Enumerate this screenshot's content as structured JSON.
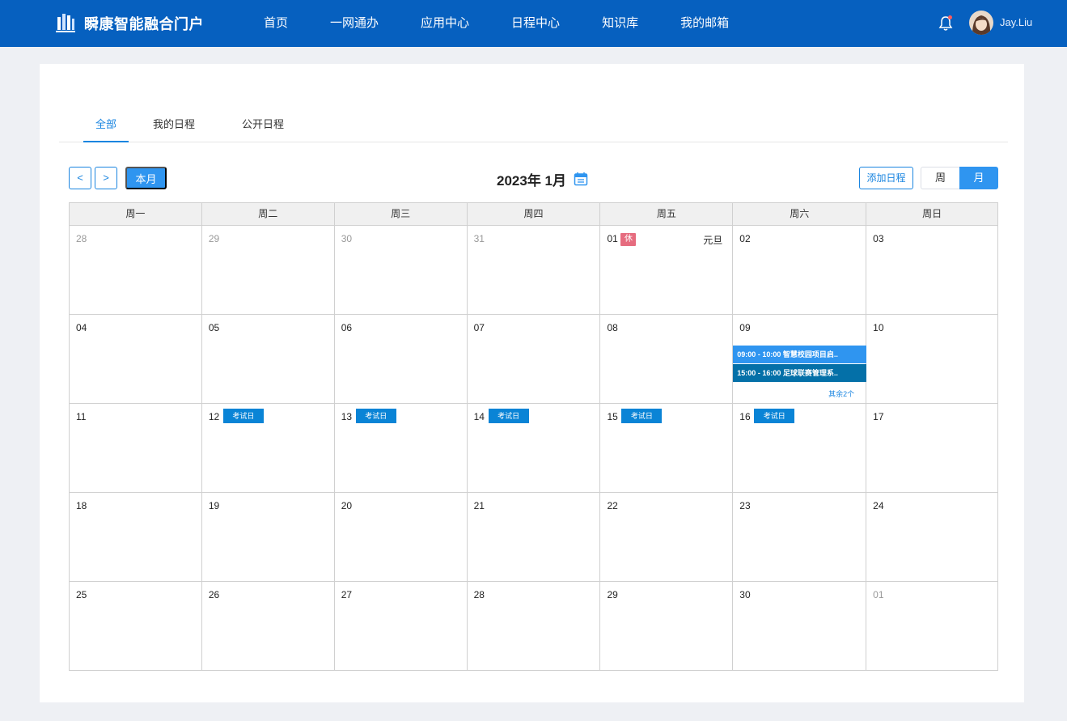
{
  "header": {
    "brand": "瞬康智能融合门户",
    "nav": [
      "首页",
      "一网通办",
      "应用中心",
      "日程中心",
      "知识库",
      "我的邮箱"
    ],
    "username": "Jay.Liu",
    "icons": {
      "bell": "bell-icon",
      "avatar": "avatar"
    },
    "colors": {
      "bar": "#0660bf"
    }
  },
  "tabs": [
    "全部",
    "我的日程",
    "公开日程"
  ],
  "toolbar": {
    "prev": "<",
    "next": ">",
    "this_month": "本月",
    "title": "2023年 1月",
    "add": "添加日程",
    "view_week": "周",
    "view_month": "月"
  },
  "calendar": {
    "weekdays": [
      "周一",
      "周二",
      "周三",
      "周四",
      "周五",
      "周六",
      "周日"
    ],
    "weeks": [
      [
        "28",
        "29",
        "30",
        "31",
        "01",
        "02",
        "03"
      ],
      [
        "04",
        "05",
        "06",
        "07",
        "08",
        "09",
        "10"
      ],
      [
        "11",
        "12",
        "13",
        "14",
        "15",
        "16",
        "17"
      ],
      [
        "18",
        "19",
        "20",
        "21",
        "22",
        "23",
        "24"
      ],
      [
        "25",
        "26",
        "27",
        "28",
        "29",
        "30",
        "01"
      ]
    ],
    "rest_badge": "休",
    "holiday_label": "元旦",
    "exam_label": "考试日",
    "events": [
      "09:00 - 10:00 智慧校园项目启..",
      "15:00 - 16:00 足球联赛管理系.."
    ],
    "more_label": "其余2个"
  }
}
